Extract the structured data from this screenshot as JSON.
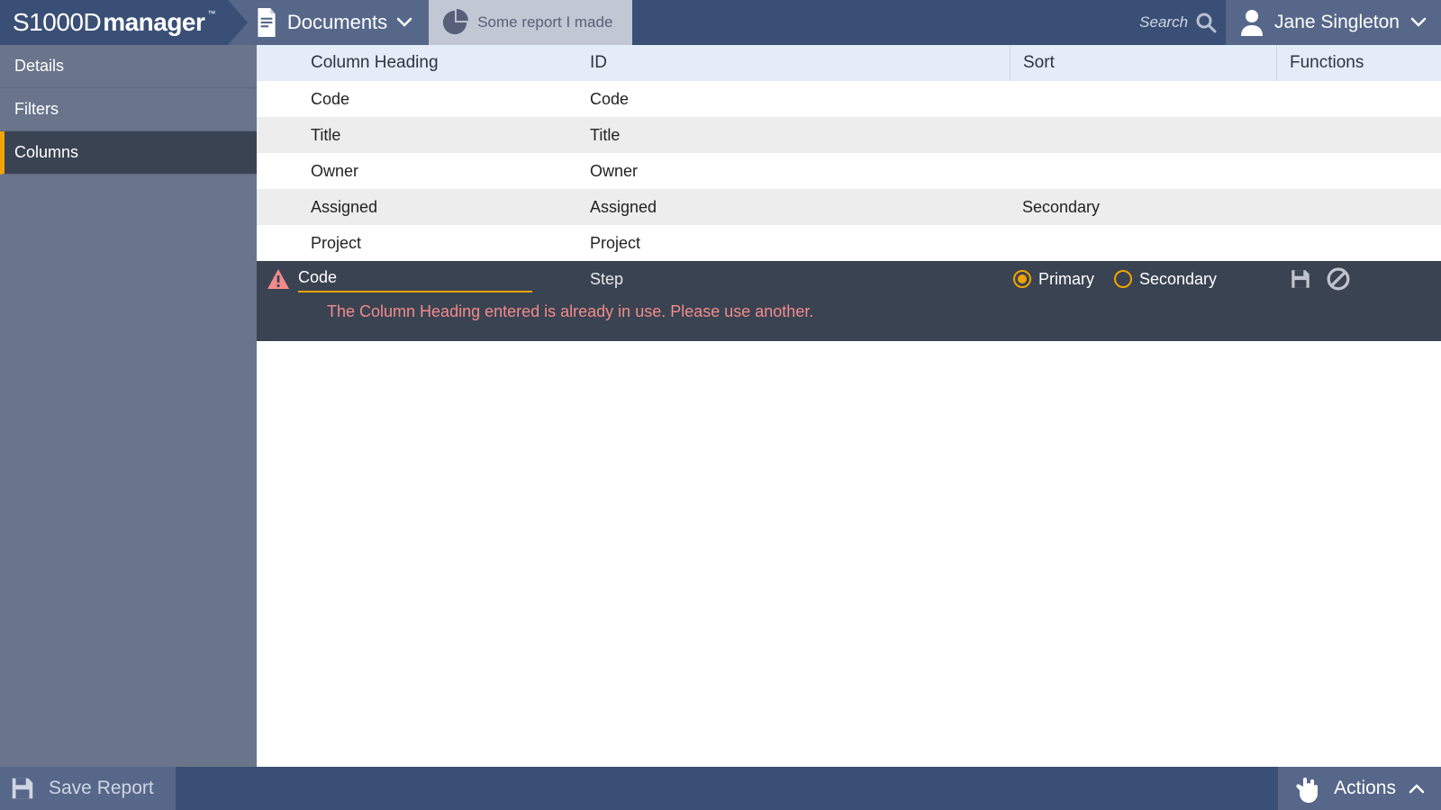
{
  "app": {
    "logo_light": "S1000D",
    "logo_bold": "manager",
    "tm": "™"
  },
  "topbar": {
    "primary_label": "Documents",
    "secondary_label": "Some report I made",
    "search_placeholder": "Search",
    "user_name": "Jane Singleton"
  },
  "sidebar": {
    "items": [
      {
        "label": "Details",
        "active": false
      },
      {
        "label": "Filters",
        "active": false
      },
      {
        "label": "Columns",
        "active": true
      }
    ]
  },
  "table": {
    "headers": {
      "heading": "Column Heading",
      "id": "ID",
      "sort": "Sort",
      "functions": "Functions"
    },
    "rows": [
      {
        "heading": "Code",
        "id": "Code",
        "sort": ""
      },
      {
        "heading": "Title",
        "id": "Title",
        "sort": ""
      },
      {
        "heading": "Owner",
        "id": "Owner",
        "sort": ""
      },
      {
        "heading": "Assigned",
        "id": "Assigned",
        "sort": "Secondary"
      },
      {
        "heading": "Project",
        "id": "Project",
        "sort": ""
      }
    ],
    "edit_row": {
      "heading_value": "Code",
      "id": "Step",
      "sort_primary_label": "Primary",
      "sort_secondary_label": "Secondary",
      "error": "The Column Heading entered is already in use. Please use another."
    }
  },
  "bottombar": {
    "save_label": "Save Report",
    "actions_label": "Actions"
  }
}
